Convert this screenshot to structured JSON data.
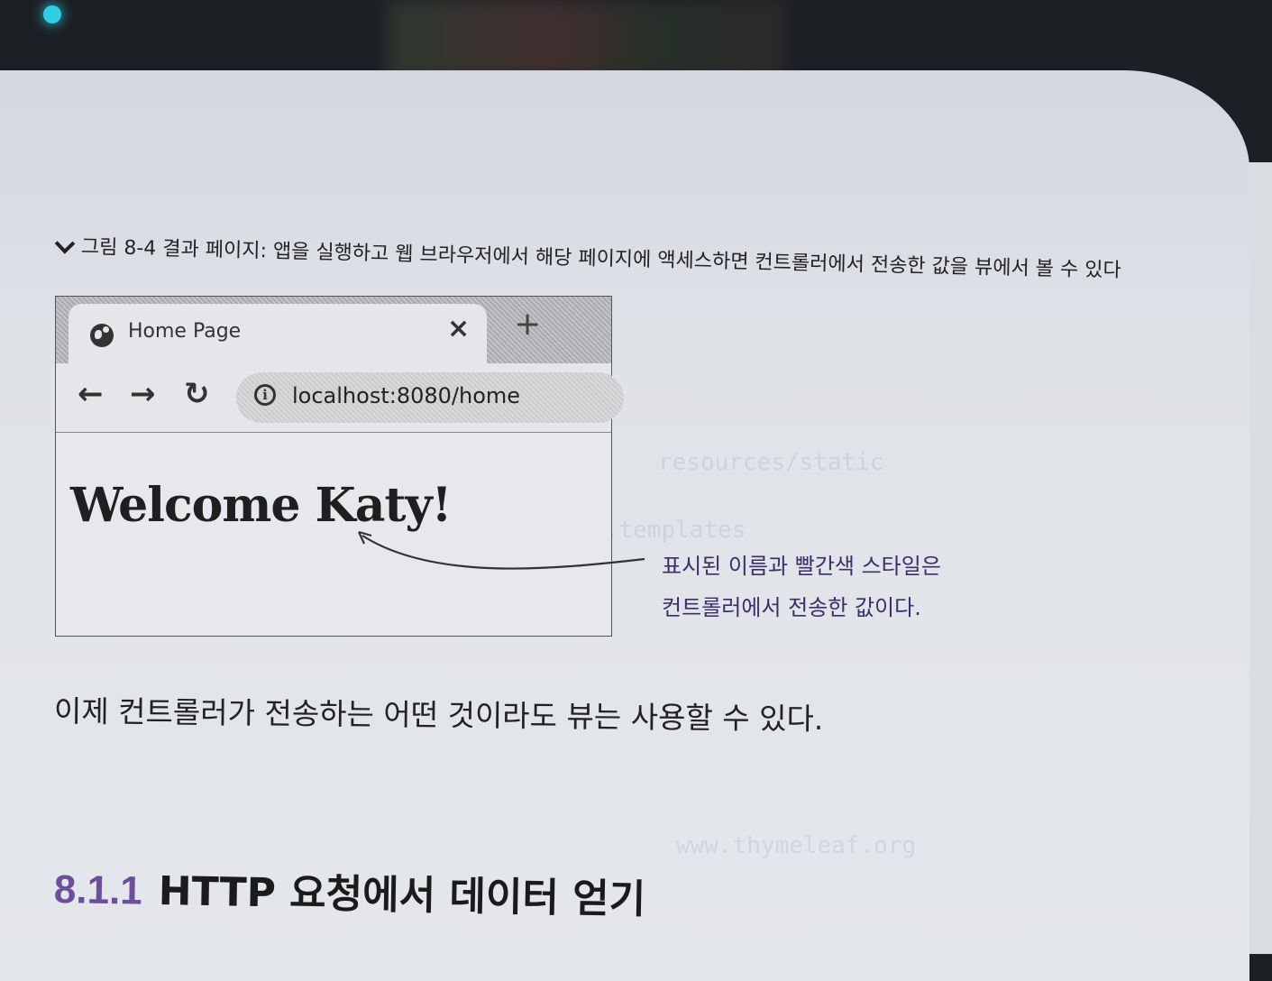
{
  "figure_caption": "그림 8-4 결과 페이지: 앱을 실행하고 웹 브라우저에서 해당 페이지에 액세스하면 컨트롤러에서 전송한 값을 뷰에서 볼 수 있다",
  "browser": {
    "tab_title": "Home Page",
    "tab_close": "×",
    "new_tab": "+",
    "back": "←",
    "forward": "→",
    "reload": "↻",
    "info": "i",
    "url": "localhost:8080/home",
    "heading": "Welcome Katy!"
  },
  "annotation": {
    "line1": "표시된 이름과 빨간색 스타일은",
    "line2": "컨트롤러에서 전송한 값이다."
  },
  "body_text": "이제 컨트롤러가 전송하는 어떤 것이라도 뷰는 사용할 수 있다.",
  "section": {
    "number": "8.1.1",
    "title": "HTTP 요청에서 데이터 얻기"
  }
}
